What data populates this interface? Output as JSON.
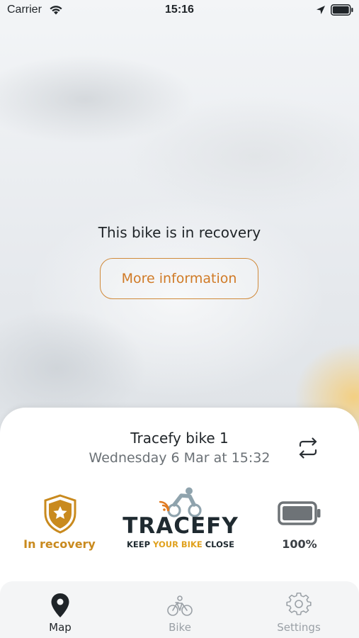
{
  "status_bar": {
    "carrier": "Carrier",
    "time": "15:16"
  },
  "map_overlay": {
    "message": "This bike is in recovery",
    "button_label": "More information"
  },
  "bike": {
    "name": "Tracefy bike 1",
    "last_seen": "Wednesday 6 Mar at 15:32",
    "status_label": "In recovery",
    "battery_label": "100%",
    "battery_level": 1.0
  },
  "logo": {
    "wordmark": "TRACEFY",
    "tagline_1": "KEEP ",
    "tagline_2": "YOUR BIKE",
    "tagline_3": " CLOSE"
  },
  "tabs": [
    {
      "label": "Map",
      "icon": "map-pin-icon",
      "active": true
    },
    {
      "label": "Bike",
      "icon": "bicycle-icon",
      "active": false
    },
    {
      "label": "Settings",
      "icon": "gear-icon",
      "active": false
    }
  ],
  "colors": {
    "accent": "#d07a26",
    "status": "#c98a1e",
    "active_tab": "#1f2428",
    "inactive_tab": "#9aa0a6"
  }
}
